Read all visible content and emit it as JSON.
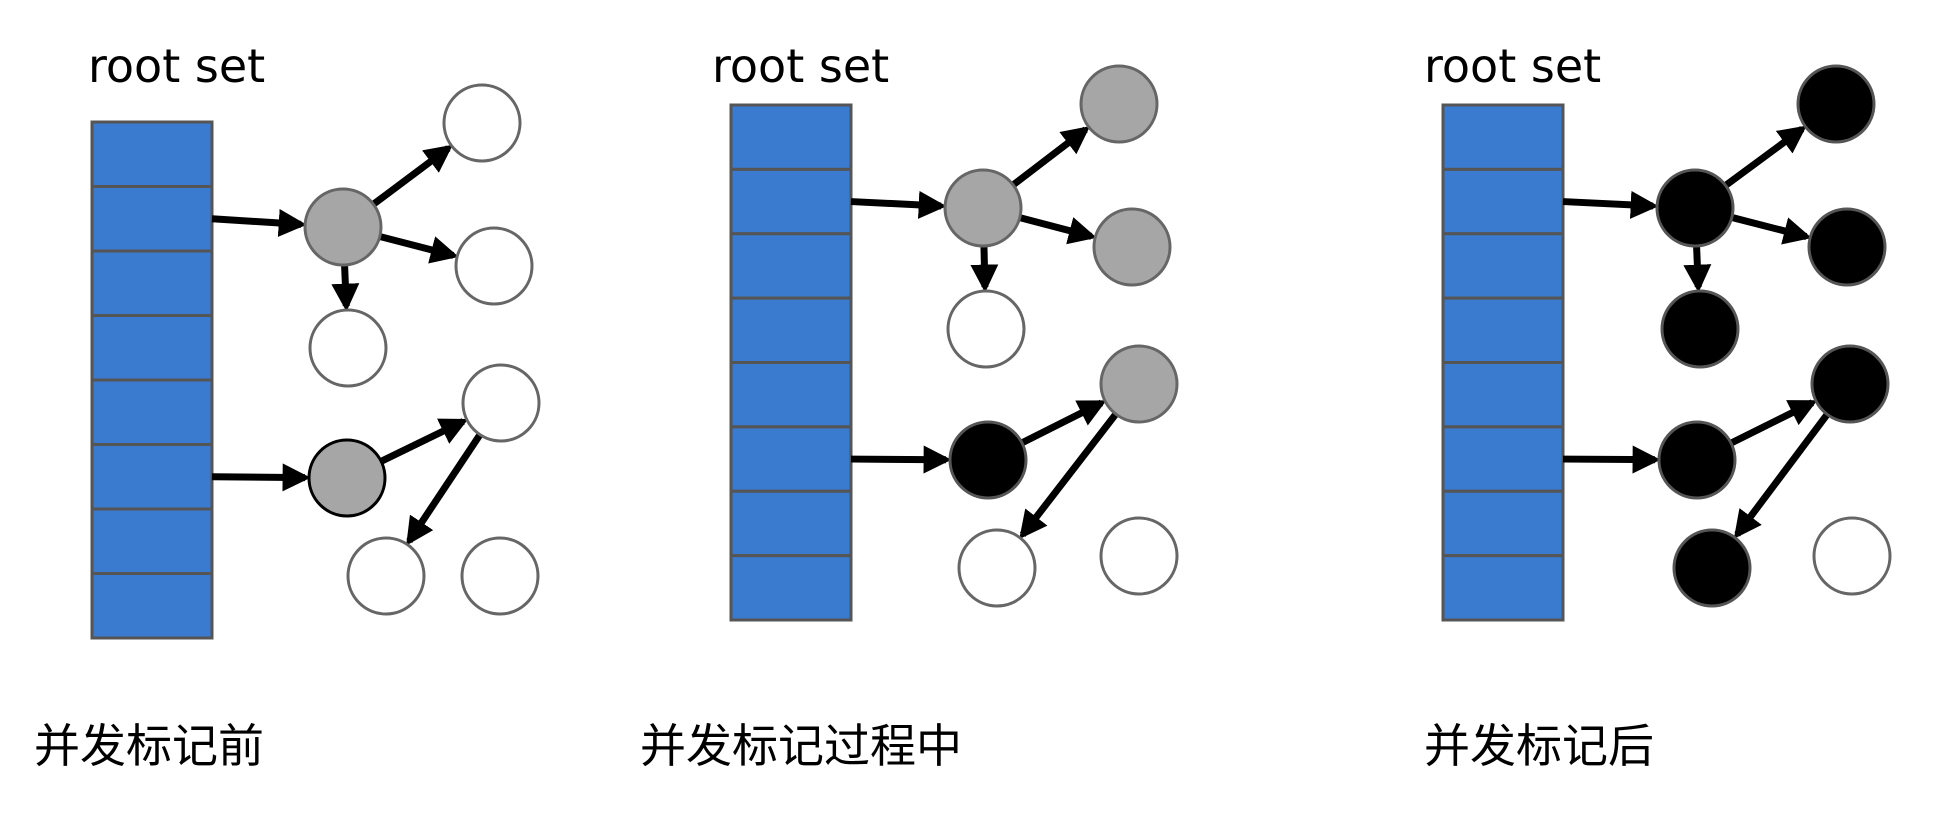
{
  "colors": {
    "root_cell": "#3a7bcf",
    "white": "#ffffff",
    "gray": "#a6a6a6",
    "black": "#000000",
    "stroke": "#666666"
  },
  "panels": [
    {
      "root_label": "root set",
      "caption": "并发标记前",
      "cells": 8,
      "nodes": [
        {
          "id": "a",
          "color": "gray"
        },
        {
          "id": "b",
          "color": "white"
        },
        {
          "id": "c",
          "color": "white"
        },
        {
          "id": "d",
          "color": "white"
        },
        {
          "id": "e",
          "color": "gray",
          "dark_border": true
        },
        {
          "id": "f",
          "color": "white"
        },
        {
          "id": "g",
          "color": "white"
        },
        {
          "id": "h",
          "color": "white"
        }
      ]
    },
    {
      "root_label": "root set",
      "caption": "并发标记过程中",
      "cells": 8,
      "nodes": [
        {
          "id": "a",
          "color": "gray"
        },
        {
          "id": "b",
          "color": "gray"
        },
        {
          "id": "c",
          "color": "gray"
        },
        {
          "id": "d",
          "color": "white"
        },
        {
          "id": "e",
          "color": "black"
        },
        {
          "id": "f",
          "color": "gray"
        },
        {
          "id": "g",
          "color": "white"
        },
        {
          "id": "h",
          "color": "white"
        }
      ]
    },
    {
      "root_label": "root set",
      "caption": "并发标记后",
      "cells": 8,
      "nodes": [
        {
          "id": "a",
          "color": "black"
        },
        {
          "id": "b",
          "color": "black"
        },
        {
          "id": "c",
          "color": "black"
        },
        {
          "id": "d",
          "color": "black"
        },
        {
          "id": "e",
          "color": "black"
        },
        {
          "id": "f",
          "color": "black"
        },
        {
          "id": "g",
          "color": "black"
        },
        {
          "id": "h",
          "color": "white"
        }
      ]
    }
  ],
  "edges": [
    {
      "from": "root2",
      "to": "a"
    },
    {
      "from": "root6",
      "to": "e"
    },
    {
      "from": "a",
      "to": "b"
    },
    {
      "from": "a",
      "to": "c"
    },
    {
      "from": "a",
      "to": "d"
    },
    {
      "from": "e",
      "to": "f"
    },
    {
      "from": "f",
      "to": "g"
    }
  ]
}
